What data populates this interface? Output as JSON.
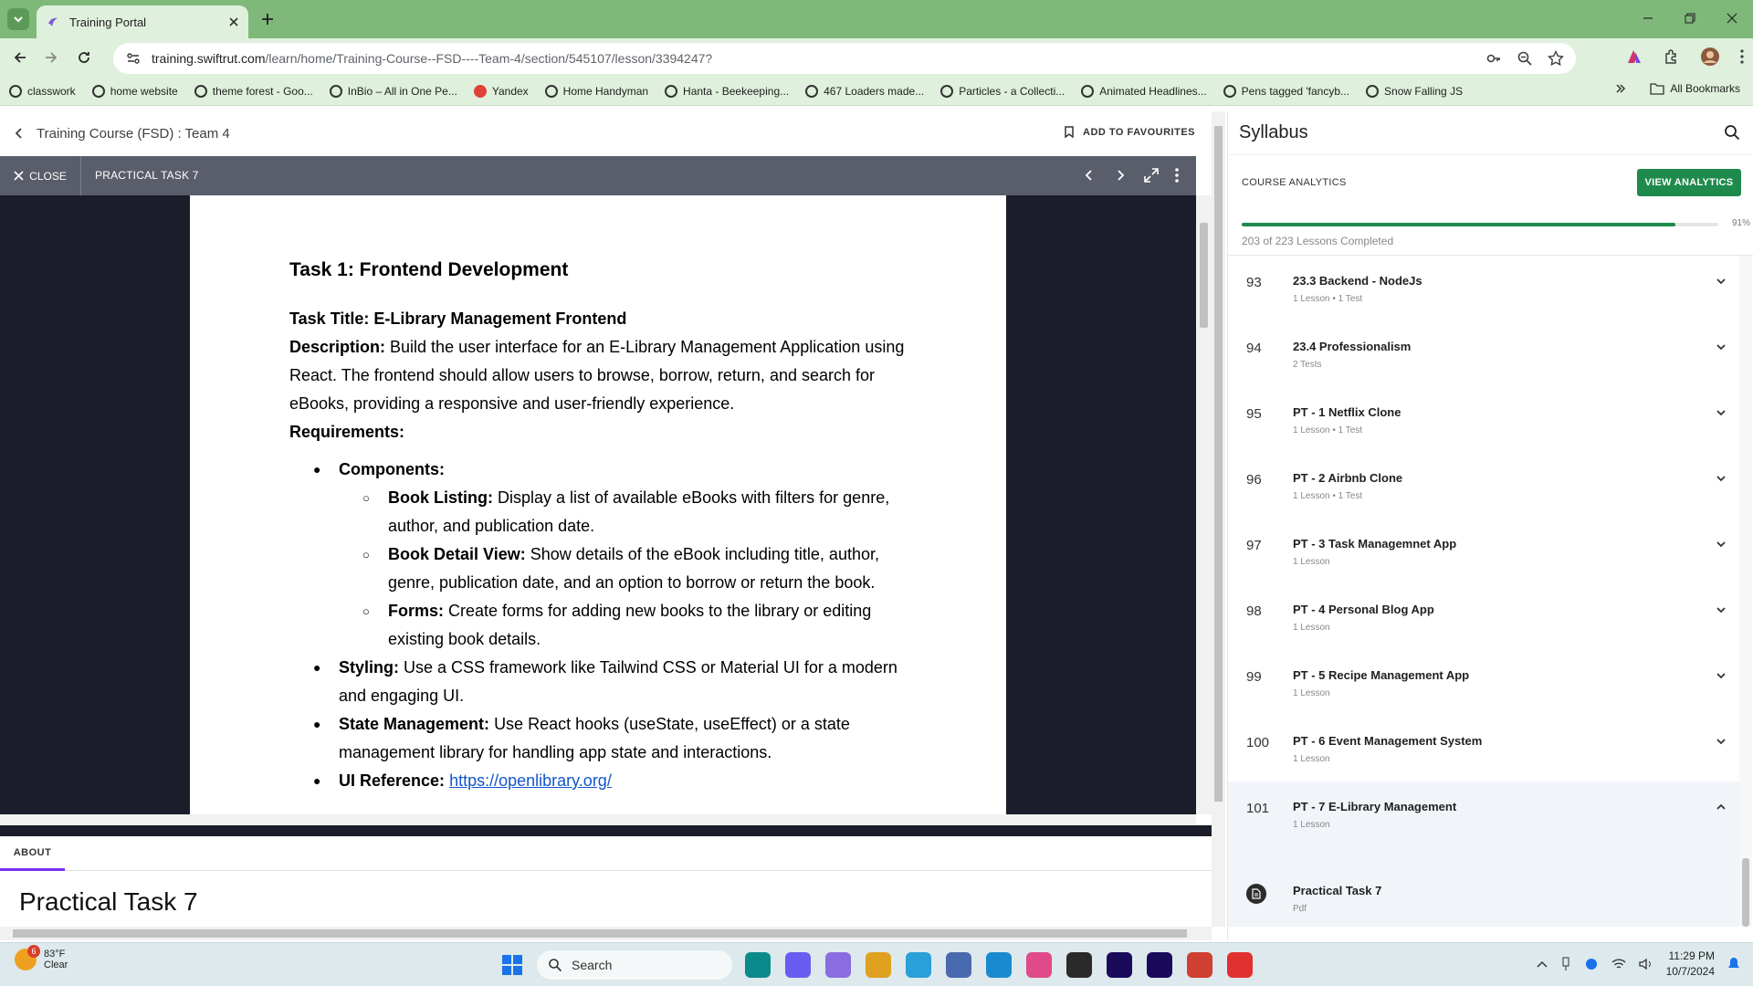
{
  "browser": {
    "tab_title": "Training Portal",
    "url_host": "training.swiftrut.com",
    "url_path": "/learn/home/Training-Course--FSD----Team-4/section/545107/lesson/3394247?",
    "bookmarks": [
      "classwork",
      "home website",
      "theme forest - Goo...",
      "InBio – All in One Pe...",
      "Yandex",
      "Home Handyman",
      "Hanta - Beekeeping...",
      "467 Loaders made...",
      "Particles - a Collecti...",
      "Animated Headlines...",
      "Pens tagged 'fancyb...",
      "Snow Falling JS"
    ],
    "all_bookmarks": "All Bookmarks"
  },
  "course": {
    "title": "Training Course (FSD) : Team 4",
    "add_favourites": "ADD TO FAVOURITES"
  },
  "viewer": {
    "close_label": "CLOSE",
    "title": "PRACTICAL TASK 7"
  },
  "doc": {
    "heading": "Task 1: Frontend Development",
    "task_title_label": "Task Title:",
    "task_title_value": "E-Library Management Frontend",
    "description_label": "Description:",
    "description_text": "Build the user interface for an E-Library Management Application using React. The frontend should allow users to browse, borrow, return, and search for eBooks, providing a responsive and user-friendly experience.",
    "requirements_label": "Requirements:",
    "components_label": "Components:",
    "book_listing_label": "Book Listing:",
    "book_listing_text": "Display a list of available eBooks with filters for genre, author, and publication date.",
    "book_detail_label": "Book Detail View:",
    "book_detail_text": "Show details of the eBook including title, author, genre, publication date, and an option to borrow or return the book.",
    "forms_label": "Forms:",
    "forms_text": "Create forms for adding new books to the library or editing existing book details.",
    "styling_label": "Styling:",
    "styling_text": "Use a CSS framework like Tailwind CSS or Material UI for a modern and engaging UI.",
    "state_label": "State Management:",
    "state_text": "Use React hooks (useState, useEffect) or a state management library for handling app state and interactions.",
    "ui_ref_label": "UI Reference:",
    "ui_ref_link": "https://openlibrary.org/"
  },
  "about": {
    "tab_label": "ABOUT",
    "title": "Practical Task 7"
  },
  "sidebar": {
    "title": "Syllabus",
    "analytics_label": "COURSE ANALYTICS",
    "view_analytics": "VIEW ANALYTICS",
    "progress_fraction": 0.91,
    "progress_pct": "91%",
    "progress_label": "203 of 223 Lessons Completed",
    "sections": [
      {
        "num": "93",
        "title": "23.3 Backend - NodeJs",
        "meta": "1 Lesson • 1 Test"
      },
      {
        "num": "94",
        "title": "23.4 Professionalism",
        "meta": "2 Tests"
      },
      {
        "num": "95",
        "title": "PT - 1 Netflix Clone",
        "meta": "1 Lesson • 1 Test"
      },
      {
        "num": "96",
        "title": "PT - 2 Airbnb Clone",
        "meta": "1 Lesson • 1 Test"
      },
      {
        "num": "97",
        "title": "PT - 3 Task Managemnet App",
        "meta": "1 Lesson"
      },
      {
        "num": "98",
        "title": "PT - 4 Personal Blog App",
        "meta": "1 Lesson"
      },
      {
        "num": "99",
        "title": "PT - 5 Recipe Management App",
        "meta": "1 Lesson"
      },
      {
        "num": "100",
        "title": "PT - 6 Event Management System",
        "meta": "1 Lesson"
      },
      {
        "num": "101",
        "title": "PT - 7 E-Library Management",
        "meta": "1 Lesson"
      }
    ],
    "active_item": {
      "title": "Practical Task 7",
      "meta": "Pdf"
    }
  },
  "taskbar": {
    "weather_temp": "83°F",
    "weather_desc": "Clear",
    "weather_badge": "6",
    "search_label": "Search",
    "time": "11:29 PM",
    "date": "10/7/2024"
  }
}
